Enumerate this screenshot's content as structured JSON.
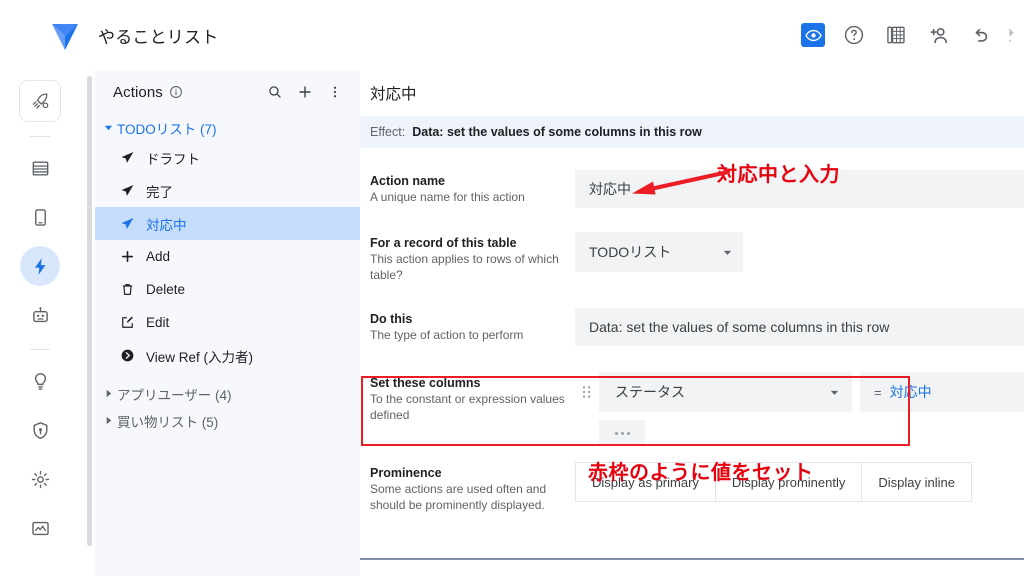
{
  "app": {
    "title": "やることリスト",
    "logo_icon": "appsheet-logo-icon"
  },
  "toolbar": {
    "items": [
      {
        "name": "preview-toggle",
        "icon": "eye-icon",
        "active": true
      },
      {
        "name": "help",
        "icon": "question-circle-icon",
        "active": false
      },
      {
        "name": "data-source",
        "icon": "spreadsheet-book-icon",
        "active": false
      },
      {
        "name": "share",
        "icon": "add-person-icon",
        "active": false
      },
      {
        "name": "undo",
        "icon": "undo-arrow-icon",
        "active": false
      },
      {
        "name": "redo",
        "icon": "redo-arrow-icon",
        "active": false
      }
    ]
  },
  "rail": {
    "items": [
      {
        "name": "launch",
        "icon": "rocket-icon",
        "state": "boxed"
      },
      {
        "name": "data",
        "icon": "table-rows-icon",
        "state": "normal"
      },
      {
        "name": "app-views",
        "icon": "mobile-device-icon",
        "state": "normal"
      },
      {
        "name": "automation",
        "icon": "lightning-bolt-icon",
        "state": "active"
      },
      {
        "name": "chat-bots",
        "icon": "robot-icon",
        "state": "normal"
      },
      {
        "name": "intelligence",
        "icon": "lightbulb-icon",
        "state": "normal"
      },
      {
        "name": "security",
        "icon": "shield-icon",
        "state": "normal"
      },
      {
        "name": "settings",
        "icon": "gear-icon",
        "state": "normal"
      },
      {
        "name": "monitor",
        "icon": "monitor-chart-icon",
        "state": "normal"
      }
    ]
  },
  "panel": {
    "title": "Actions",
    "info_icon": "info-circle-icon",
    "search_icon": "search-icon",
    "add_icon": "plus-icon",
    "more_icon": "more-vert-icon",
    "groups": [
      {
        "label": "TODOリスト (7)",
        "expanded": true,
        "caret_icon": "caret-down-icon",
        "items": [
          {
            "label": "ドラフト",
            "icon": "paper-plane-icon",
            "selected": false
          },
          {
            "label": "完了",
            "icon": "paper-plane-icon",
            "selected": false
          },
          {
            "label": "対応中",
            "icon": "paper-plane-icon",
            "selected": true
          },
          {
            "label": "Add",
            "icon": "plus-icon",
            "selected": false
          },
          {
            "label": "Delete",
            "icon": "trash-icon",
            "selected": false
          },
          {
            "label": "Edit",
            "icon": "pencil-square-icon",
            "selected": false
          },
          {
            "label": "View Ref (入力者)",
            "icon": "arrow-circle-right-icon",
            "selected": false
          }
        ]
      },
      {
        "label": "アプリユーザー (4)",
        "expanded": false,
        "caret_icon": "caret-right-icon",
        "items": []
      },
      {
        "label": "買い物リスト (5)",
        "expanded": false,
        "caret_icon": "caret-right-icon",
        "items": []
      }
    ]
  },
  "main": {
    "title": "対応中",
    "effect": {
      "key": "Effect:",
      "value": "Data: set the values of some columns in this row"
    },
    "action_name": {
      "label": "Action name",
      "hint": "A unique name for this action",
      "value": "対応中"
    },
    "table": {
      "label": "For a record of this table",
      "hint": "This action applies to rows of which table?",
      "value": "TODOリスト",
      "caret_icon": "chevron-down-icon"
    },
    "do_this": {
      "label": "Do this",
      "hint": "The type of action to perform",
      "value": "Data: set the values of some columns in this row"
    },
    "set_columns": {
      "label": "Set these columns",
      "hint": "To the constant or expression values defined",
      "drag_icon": "drag-handle-icon",
      "column": "ステータス",
      "caret_icon": "chevron-down-icon",
      "equals": "=",
      "value": "対応中"
    },
    "prominence": {
      "label": "Prominence",
      "hint": "Some actions are used often and should be prominently displayed.",
      "options": [
        "Display as primary",
        "Display prominently",
        "Display inline"
      ]
    }
  },
  "annotations": {
    "color": "#e8000d",
    "input_note": "対応中と入力",
    "columns_note": "赤枠のように値をセット",
    "arrow_icon": "red-arrow-left-icon",
    "red_box_icon": "red-highlight-box"
  }
}
